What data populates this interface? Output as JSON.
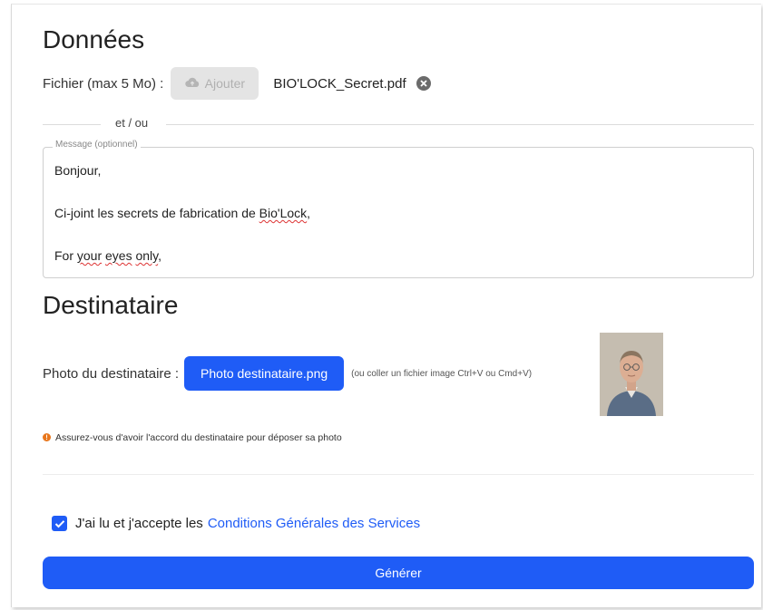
{
  "data_section": {
    "title": "Données",
    "file_label": "Fichier  (max 5 Mo) :",
    "add_button_label": "Ajouter",
    "file_name": "BIO'LOCK_Secret.pdf",
    "divider_text": "et / ou",
    "message_legend": "Message (optionnel)",
    "message": {
      "line1": "Bonjour,",
      "line2_prefix": "Ci-joint les secrets de fabrication de ",
      "line2_word": "Bio'Lock",
      "line2_suffix": ",",
      "line3_prefix": "For ",
      "line3_word1": "your",
      "line3_space": " ",
      "line3_word2": "eyes",
      "line3_word3": "only",
      "line3_suffix": ","
    }
  },
  "recipient_section": {
    "title": "Destinataire",
    "photo_label": "Photo du destinataire :",
    "photo_button_label": "Photo destinataire.png",
    "paste_hint": "(ou coller un fichier image Ctrl+V ou Cmd+V)",
    "notice": "Assurez-vous d'avoir l'accord du destinataire pour déposer sa photo"
  },
  "consent": {
    "checked": true,
    "text": "J'ai lu et j'accepte les",
    "link_text": "Conditions Générales des Services"
  },
  "generate_button_label": "Générer",
  "colors": {
    "accent": "#1f5cf6",
    "notice_dot": "#e8761c",
    "disabled_button": "#e4e4e4"
  },
  "icons": {
    "add_button": "cloud-upload-icon",
    "remove_file": "close-circle-icon",
    "notice": "warning-dot-icon",
    "checkbox": "checkmark-icon"
  }
}
